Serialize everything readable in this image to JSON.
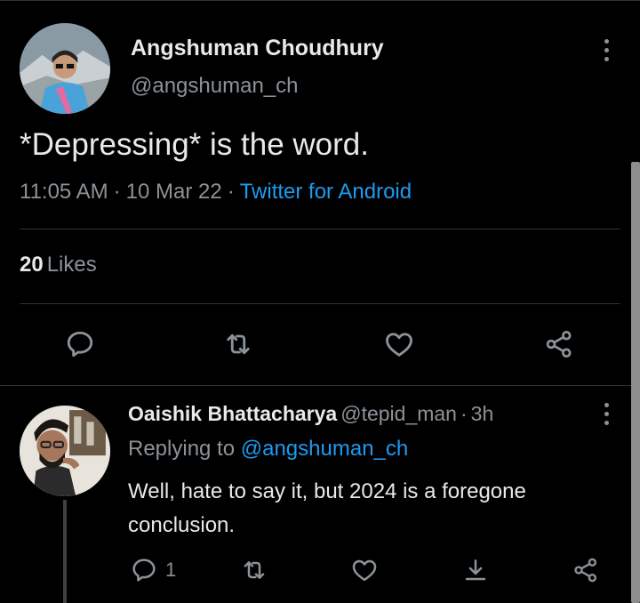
{
  "tweet": {
    "author_name": "Angshuman Choudhury",
    "author_handle": "@angshuman_ch",
    "text": "*Depressing* is the word.",
    "time": "11:05 AM",
    "date": "10 Mar 22",
    "separator": "·",
    "source": "Twitter for Android",
    "likes_count": "20",
    "likes_label": "Likes"
  },
  "reply": {
    "author_name": "Oaishik Bhattacharya",
    "author_handle": "@tepid_man",
    "separator": "·",
    "age": "3h",
    "replying_prefix": "Replying to",
    "replying_to": "@angshuman_ch",
    "text": "Well, hate to say it, but 2024 is a foregone conclusion.",
    "reply_count": "1"
  },
  "icons": {
    "more": "more-vertical-icon",
    "reply": "speech-bubble-icon",
    "retweet": "retweet-icon",
    "like": "heart-icon",
    "share": "share-icon",
    "bookmark": "download-arrow-icon"
  },
  "colors": {
    "background": "#000000",
    "primary_text": "#e7e9ea",
    "secondary_text": "#8b9298",
    "link": "#1d9bf0",
    "divider": "#2f3336"
  }
}
